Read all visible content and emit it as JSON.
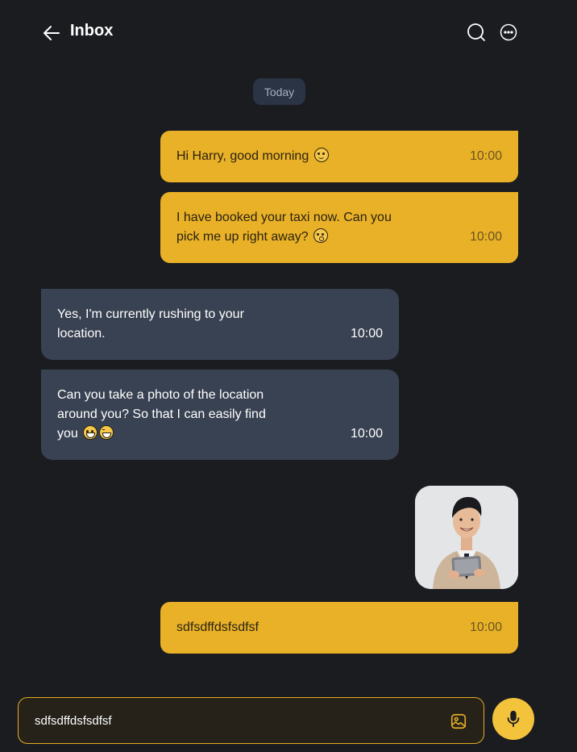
{
  "header": {
    "title": "Inbox",
    "back_icon": "arrow-left-icon",
    "search_icon": "search-icon",
    "more_icon": "more-horizontal-icon"
  },
  "date_separator": "Today",
  "messages": [
    {
      "direction": "sent",
      "lines": [
        "Hi Harry, good morning"
      ],
      "emoji": [
        "smile"
      ],
      "time": "10:00"
    },
    {
      "direction": "sent",
      "lines": [
        "I have booked your taxi now. Can you",
        "pick me up right away?"
      ],
      "emoji": [
        "surprised"
      ],
      "time": "10:00"
    },
    {
      "direction": "received",
      "lines": [
        "Yes, I'm currently rushing to your",
        "location."
      ],
      "emoji": [],
      "time": "10:00"
    },
    {
      "direction": "received",
      "lines": [
        "Can you take a photo of the location",
        "around you? So that I can easily find",
        "you"
      ],
      "emoji": [
        "grin",
        "squint"
      ],
      "time": "10:00"
    },
    {
      "direction": "sent",
      "type": "image",
      "image_icon": "photo-of-man-holding-tablet"
    },
    {
      "direction": "sent",
      "lines": [
        "sdfsdffdsfsdfsf"
      ],
      "emoji": [],
      "time": "10:00"
    }
  ],
  "composer": {
    "value": "sdfsdffdsfsdfsf",
    "attach_icon": "image-icon",
    "mic_icon": "microphone-icon"
  },
  "colors": {
    "background": "#1b1c20",
    "sent_bubble": "#e9b127",
    "received_bubble": "#394252",
    "accent": "#f3c33b"
  }
}
